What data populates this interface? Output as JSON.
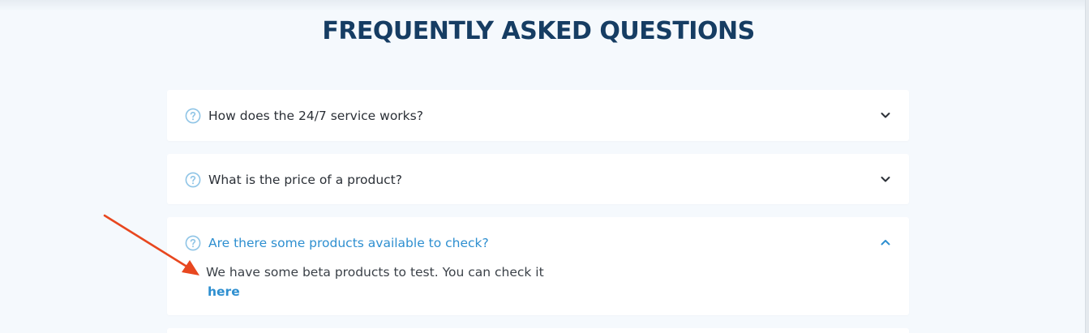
{
  "page_title": "FREQUENTLY ASKED QUESTIONS",
  "colors": {
    "title": "#163d63",
    "accent": "#2e8fd0",
    "icon": "#8ec4e6",
    "annotation_arrow": "#e8471f"
  },
  "faq": {
    "items": [
      {
        "question": "How does the 24/7 service works?",
        "expanded": false,
        "icon": "question-circle-icon",
        "toggle_icon": "chevron-down-icon"
      },
      {
        "question": "What is the price of a product?",
        "expanded": false,
        "icon": "question-circle-icon",
        "toggle_icon": "chevron-down-icon"
      },
      {
        "question": "Are there some products available to check?",
        "expanded": true,
        "icon": "question-circle-icon",
        "toggle_icon": "chevron-up-icon",
        "answer": "We have some beta products to test. You can check it",
        "answer_link": "here"
      }
    ]
  }
}
